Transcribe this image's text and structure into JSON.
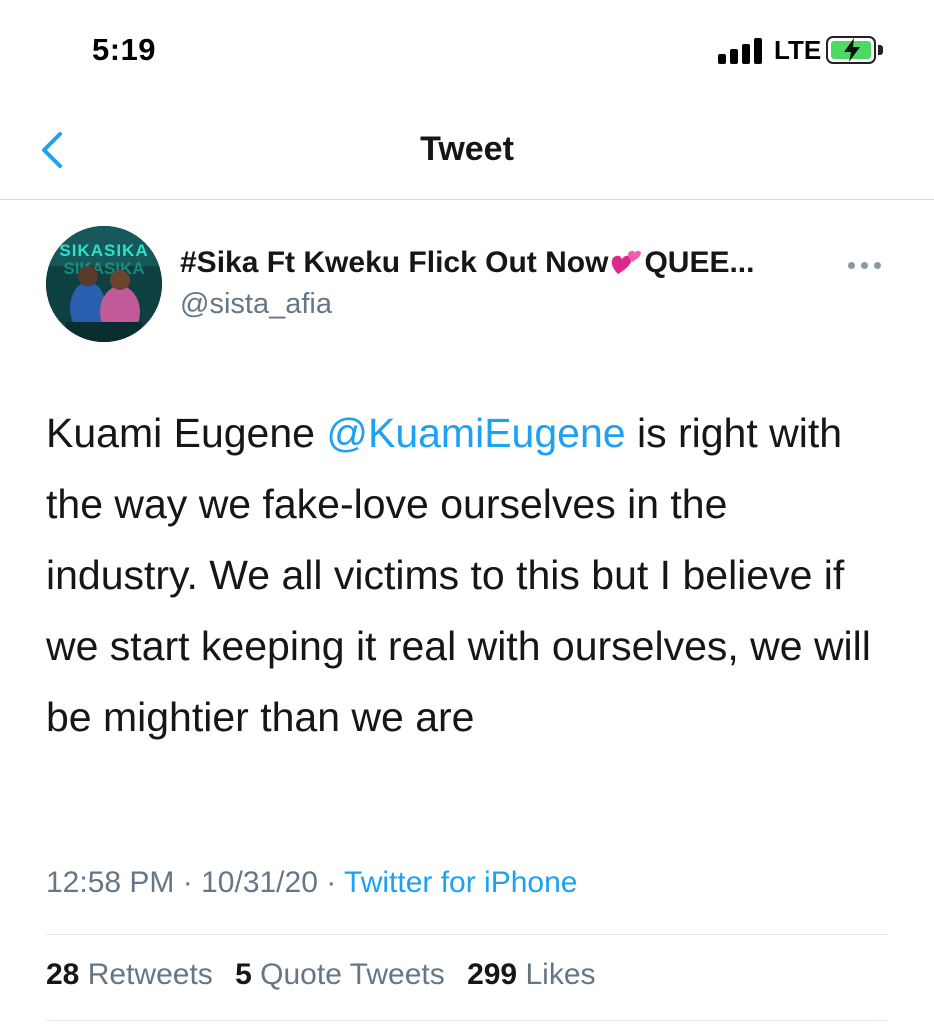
{
  "status_bar": {
    "time": "5:19",
    "network": "LTE",
    "battery_state": "charging",
    "battery_color": "#4cd964"
  },
  "nav": {
    "title": "Tweet",
    "back_icon": "chevron-left-icon",
    "accent": "#1da1f2"
  },
  "author": {
    "display_name": "#Sika Ft Kweku Flick Out Now",
    "display_name_suffix": "QUEE...",
    "emoji_icon": "two-hearts-icon",
    "username": "@sista_afia",
    "avatar_text": "SIKASIKA",
    "more_icon": "ellipsis-icon"
  },
  "tweet": {
    "text_before": "Kuami Eugene ",
    "mention": "@KuamiEugene",
    "text_after": " is right with the way we fake-love ourselves in the industry. We all victims to this but I believe if we start keeping it real with ourselves, we will be mightier than we are"
  },
  "meta": {
    "time": "12:58 PM",
    "date": "10/31/20",
    "separator": "·",
    "source": "Twitter for iPhone"
  },
  "stats": {
    "retweets_count": "28",
    "retweets_label": "Retweets",
    "quotes_count": "5",
    "quotes_label": "Quote Tweets",
    "likes_count": "299",
    "likes_label": "Likes"
  }
}
